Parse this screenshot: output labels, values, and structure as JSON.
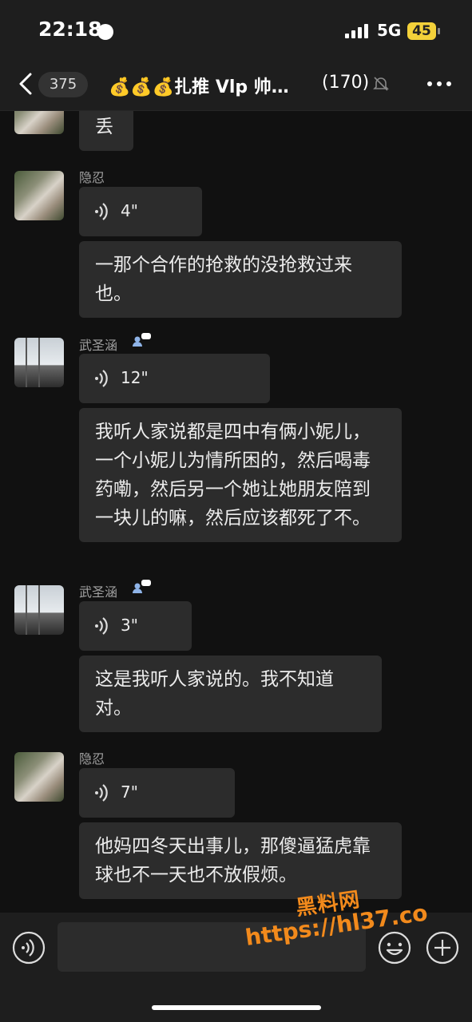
{
  "status_bar": {
    "time": "22:18",
    "network": "5G",
    "battery": "45"
  },
  "header": {
    "unread_count": "375",
    "title": "💰💰💰扎推 Vlp 帅…",
    "member_count": "(170)"
  },
  "messages": [
    {
      "type": "text",
      "text": "丢"
    },
    {
      "sender": "隐忍",
      "type": "voice",
      "duration": "4\""
    },
    {
      "type": "text",
      "text": "一那个合作的抢救的没抢救过来也。"
    },
    {
      "sender": "武圣涵",
      "type": "voice",
      "duration": "12\""
    },
    {
      "type": "text",
      "text": "我听人家说都是四中有俩小妮儿，一个小妮儿为情所困的，然后喝毒药嘞，然后另一个她让她朋友陪到一块儿的嘛，然后应该都死了不。"
    },
    {
      "sender": "武圣涵",
      "type": "voice",
      "duration": "3\""
    },
    {
      "type": "text",
      "text": "这是我听人家说的。我不知道对。"
    },
    {
      "sender": "隐忍",
      "type": "voice",
      "duration": "7\""
    },
    {
      "type": "text",
      "text": "他妈四冬天出事儿，那傻逼猛虎靠球也不一天也不放假烦。"
    }
  ],
  "watermark": {
    "line1": "黑料网",
    "line2": "https://hl37.co"
  },
  "colors": {
    "background": "#111111",
    "bubble": "#2c2c2c",
    "bar": "#1e1e1e",
    "watermark": "#f28a1c"
  },
  "icons": [
    "back-icon",
    "mute-icon",
    "more-icon",
    "voice-wave-icon",
    "emoji-icon",
    "plus-icon",
    "voice-input-icon"
  ]
}
